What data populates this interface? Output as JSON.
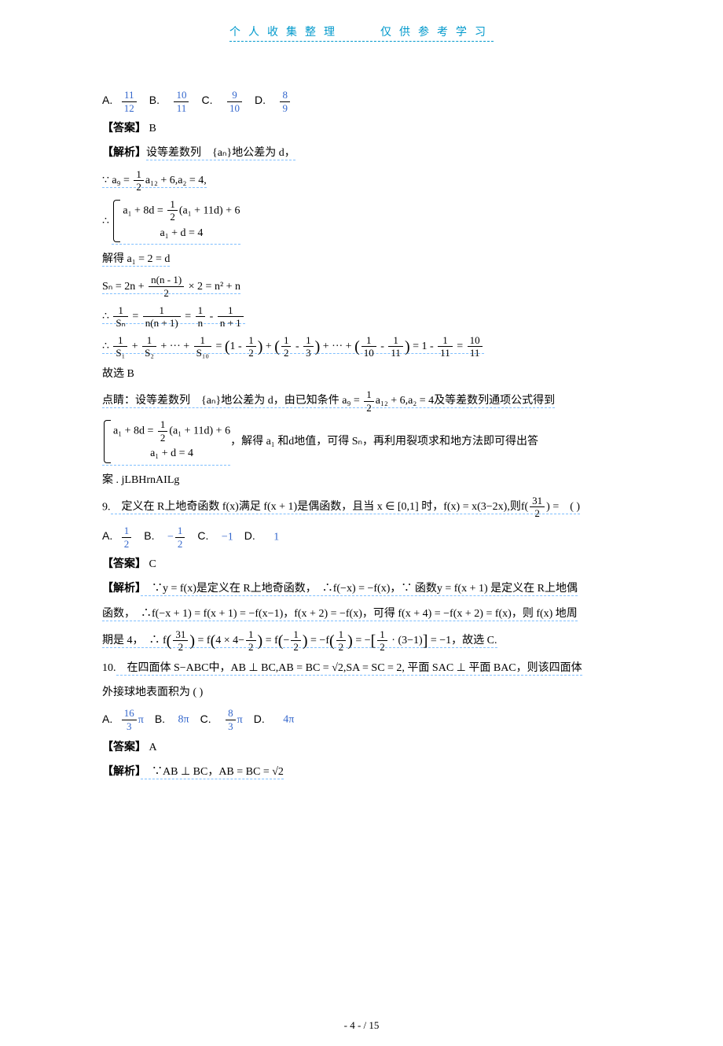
{
  "header": {
    "title": "个人收集整理　　仅供参考学习"
  },
  "q8_choices": {
    "A": {
      "label": "A.",
      "num": "11",
      "den": "12"
    },
    "B": {
      "label": "B.",
      "num": "10",
      "den": "11"
    },
    "C": {
      "label": "C.",
      "num": "9",
      "den": "10"
    },
    "D": {
      "label": "D.",
      "num": "8",
      "den": "9"
    }
  },
  "q8_answer_label": "【答案】",
  "q8_answer": "B",
  "q8_expl_label": "【解析】",
  "q8_expl_text1": "设等差数列　{aₙ}地公差为 d，",
  "q8_step1_a": "∵ a₉ = ",
  "q8_step1_b": "a₁₂ + 6,a₂ = 4,",
  "q8_step2_intro": "∴",
  "q8_step2_line1a": "a₁ + 8d = ",
  "q8_step2_line1b": "(a₁ + 11d) + 6",
  "q8_step2_line2": "a₁ + d = 4",
  "q8_step3": "解得 a₁ = 2 = d",
  "q8_step4a": "Sₙ = 2n + ",
  "q8_step4_num": "n(n - 1)",
  "q8_step4_den": "2",
  "q8_step4b": " × 2 = n² + n",
  "q8_step5a": "∴ ",
  "q8_step5_f1_num": "1",
  "q8_step5_f1_den": "Sₙ",
  "q8_step5_eq": " = ",
  "q8_step5_f2_num": "1",
  "q8_step5_f2_den": "n(n + 1)",
  "q8_step5_f3_num": "1",
  "q8_step5_f3_den": "n",
  "q8_step5_minus": " - ",
  "q8_step5_f4_num": "1",
  "q8_step5_f4_den": "n + 1",
  "q8_step6a": "∴ ",
  "q8_step6_s1": "S₁",
  "q8_step6_s2": "S₂",
  "q8_step6_dots": " + ··· + ",
  "q8_step6_s10": "S₁₀",
  "q8_step6_mid": " = ",
  "q8_step6_p1a": "1 - ",
  "q8_step6_p2a": " - ",
  "q8_step6_p3a": " - ",
  "q8_step6_end": " = 1 - ",
  "q8_step6_f11": "11",
  "q8_step6_r": "10",
  "q8_conclude": "故选 B",
  "q8_note_a": "点睛：设等差数列　{aₙ}地公差为 d，由已知条件 a₉ = ",
  "q8_note_b": "a₁₂ + 6,a₂ = 4及等差数列通项公式得到",
  "q8_note2_line1a": "a₁ + 8d = ",
  "q8_note2_line1b": "(a₁ + 11d) + 6",
  "q8_note2_line2": "a₁ + d = 4",
  "q8_note2_after": "，解得 a₁ 和d地值，可得 Sₙ，再利用裂项求和地方法即可得出答",
  "q8_note3": "案 . jLBHrnAILg",
  "q9_num": "9.",
  "q9_stem_a": "　定义在 R上地奇函数 f(x)满足 f(x + 1)是偶函数，且当 x ∈ [0,1] 时，f(x) = x(3−2x),则f(",
  "q9_stem_f_num": "31",
  "q9_stem_f_den": "2",
  "q9_stem_b": ") =　(  )",
  "q9_choices": {
    "A": {
      "label": "A.",
      "num": "1",
      "den": "2"
    },
    "B": {
      "label": "B.",
      "text_a": "−",
      "num": "1",
      "den": "2"
    },
    "C": {
      "label": "C.",
      "text": "−1"
    },
    "D": {
      "label": "D.",
      "text": "1"
    }
  },
  "q9_answer_label": "【答案】",
  "q9_answer": "C",
  "q9_expl_label": "【解析】",
  "q9_expl_1": "　∵y = f(x)是定义在 R上地奇函数，　∴f(−x) = −f(x)，∵ 函数y = f(x + 1) 是定义在 R上地偶",
  "q9_expl_2": "函数，　∴f(−x + 1) = f(x + 1) = −f(x−1)，f(x + 2) = −f(x)，可得 f(x + 4) = −f(x + 2) = f(x)，则 f(x) 地周",
  "q9_expl_3a": "期是 4，　∴ f",
  "q9_expl_3_f1_num": "31",
  "q9_expl_3_f1_den": "2",
  "q9_expl_3b": " = f",
  "q9_expl_3_inner_a": "4 × 4−",
  "q9_expl_3_inner_num": "1",
  "q9_expl_3_inner_den": "2",
  "q9_expl_3c": " = f",
  "q9_expl_3_fn_a": "−",
  "q9_expl_3_fn_num": "1",
  "q9_expl_3_fn_den": "2",
  "q9_expl_3d": " = −f",
  "q9_expl_3e": " = −",
  "q9_expl_3_br_a": " · (3−1)",
  "q9_expl_3f": " = −1，故选  C.",
  "q10_num": "10.",
  "q10_stem": "　在四面体 S−ABC中，AB ⊥ BC,AB = BC = √2,SA = SC = 2, 平面 SAC ⊥ 平面 BAC，则该四面体",
  "q10_stem2": "外接球地表面积为 ( )",
  "q10_choices": {
    "A": {
      "label": "A.",
      "num": "16",
      "den": "3",
      "suffix": "π"
    },
    "B": {
      "label": "B.",
      "text": "8π"
    },
    "C": {
      "label": "C.",
      "num": "8",
      "den": "3",
      "suffix": "π"
    },
    "D": {
      "label": "D.",
      "text": "4π"
    }
  },
  "q10_answer_label": "【答案】",
  "q10_answer": "A",
  "q10_expl_label": "【解析】",
  "q10_expl_1": "　∵AB ⊥ BC，AB = BC = √2",
  "footer": "- 4 - / 15"
}
